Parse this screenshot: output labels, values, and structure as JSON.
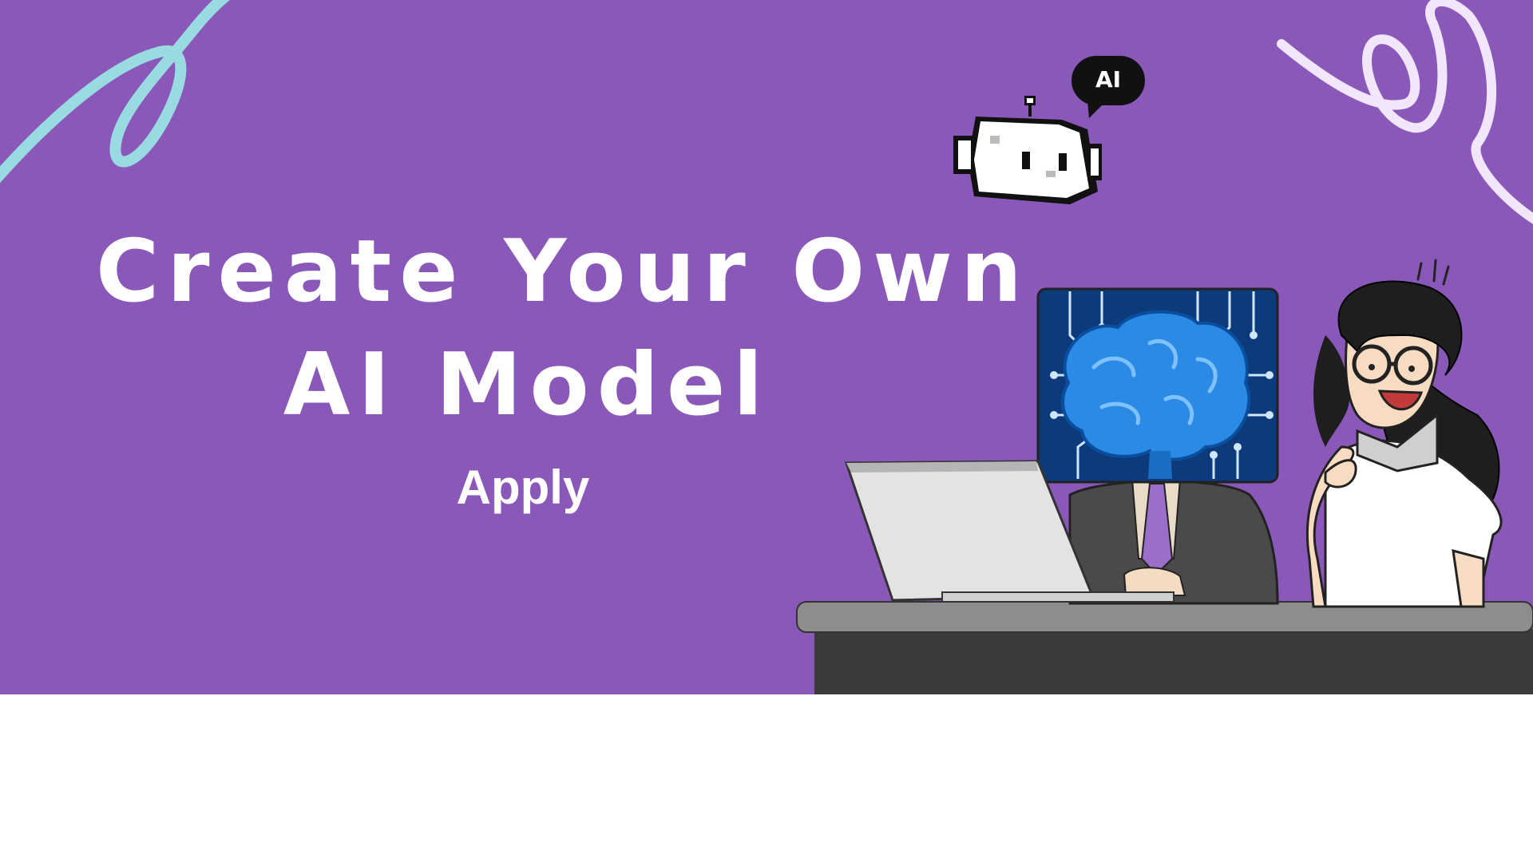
{
  "colors": {
    "background": "#8a58b9",
    "text": "#ffffff",
    "desk_top": "#8d8d8d",
    "desk_front": "#3a3a3a",
    "swirl_left": "#9adbe2",
    "swirl_right": "#f1e6fb",
    "monitor_bg": "#0c3a7a",
    "brain": "#2b8be4"
  },
  "headline": {
    "line1": "Create Your Own",
    "line2": "AI Model"
  },
  "apply_label": "Apply",
  "robot": {
    "speech_text": "AI"
  },
  "icons": [
    "swirl-left-decoration",
    "swirl-right-decoration",
    "pixel-robot-icon",
    "speech-bubble-icon",
    "brain-circuit-monitor",
    "laptop-illustration",
    "businessman-illustration",
    "girl-with-glasses-illustration",
    "desk-illustration"
  ]
}
